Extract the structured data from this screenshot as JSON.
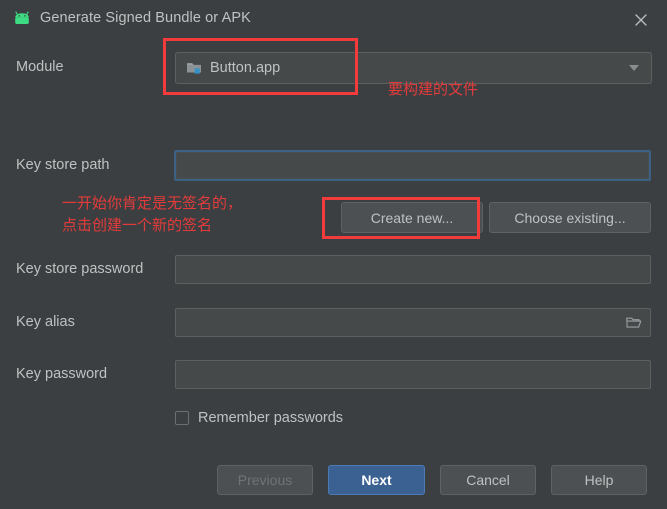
{
  "window": {
    "title": "Generate Signed Bundle or APK",
    "app_icon": "android-robot-icon",
    "close_icon": "close-icon"
  },
  "form": {
    "module": {
      "label": "Module",
      "value": "Button.app",
      "icon": "module-folder-icon",
      "dropdown_icon": "chevron-down-icon",
      "placeholder": ""
    },
    "key_store_path": {
      "label": "Key store path",
      "value": "",
      "placeholder": "",
      "focused": true
    },
    "create_new_button": "Create new...",
    "choose_existing_button": "Choose existing...",
    "key_store_password": {
      "label": "Key store password",
      "value": "",
      "placeholder": ""
    },
    "key_alias": {
      "label": "Key alias",
      "value": "",
      "placeholder": "",
      "browse_icon": "folder-open-icon"
    },
    "key_password": {
      "label": "Key password",
      "value": "",
      "placeholder": ""
    },
    "remember_passwords": {
      "label": "Remember passwords",
      "checked": false
    }
  },
  "footer": {
    "previous": "Previous",
    "next": "Next",
    "cancel": "Cancel",
    "help": "Help"
  },
  "annotations": {
    "module_note": "要构建的文件",
    "create_new_note_line1": "一开始你肯定是无签名的，",
    "create_new_note_line2": "点击创建一个新的签名"
  },
  "colors": {
    "dialog_bg": "#3c3f41",
    "field_bg": "#45494a",
    "text": "#bfc1c2",
    "accent_blue": "#3b6193",
    "focus_border": "#3d6185",
    "annotation_red": "#e33b3b",
    "android_green": "#3ddc84"
  }
}
